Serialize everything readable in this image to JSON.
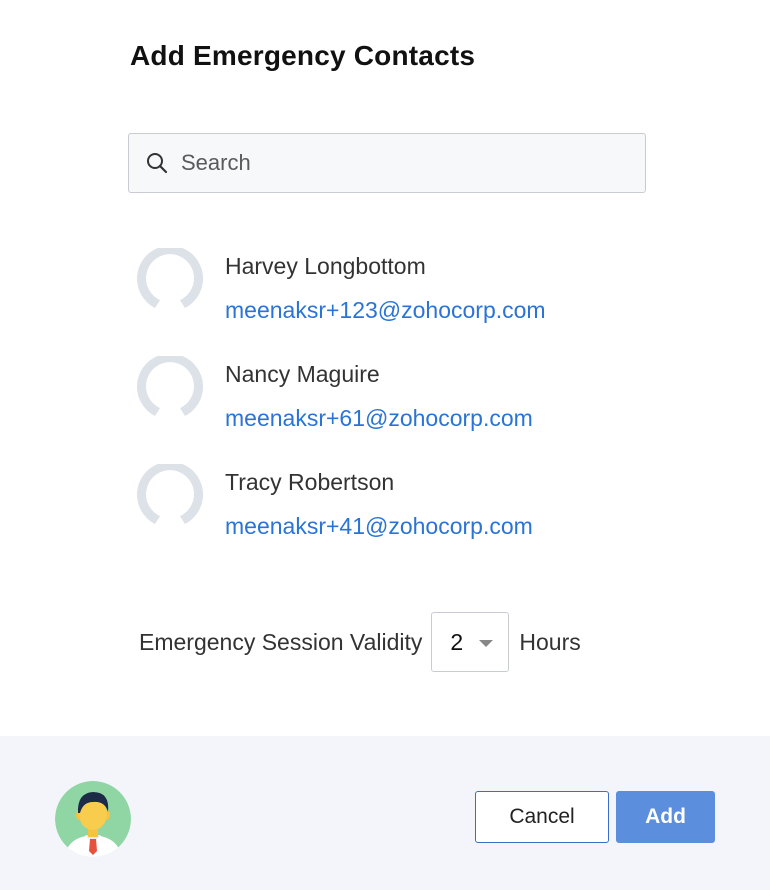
{
  "dialog": {
    "title": "Add Emergency Contacts"
  },
  "search": {
    "placeholder": "Search",
    "value": "",
    "icon": "search-icon"
  },
  "contacts": [
    {
      "name": "Harvey Longbottom",
      "email": "meenaksr+123@zohocorp.com",
      "avatar_icon": "default-avatar-icon"
    },
    {
      "name": "Nancy Maguire",
      "email": "meenaksr+61@zohocorp.com",
      "avatar_icon": "default-avatar-icon"
    },
    {
      "name": "Tracy Robertson",
      "email": "meenaksr+41@zohocorp.com",
      "avatar_icon": "default-avatar-icon"
    }
  ],
  "validity": {
    "label": "Emergency Session Validity",
    "selected_value": "2",
    "unit": "Hours"
  },
  "footer": {
    "user_avatar_icon": "user-avatar-icon",
    "cancel_label": "Cancel",
    "add_label": "Add"
  },
  "colors": {
    "link": "#2a74d6",
    "primary_button": "#5b8fde",
    "footer_background": "#f3f5fa",
    "avatar_placeholder": "#dde1e8"
  }
}
